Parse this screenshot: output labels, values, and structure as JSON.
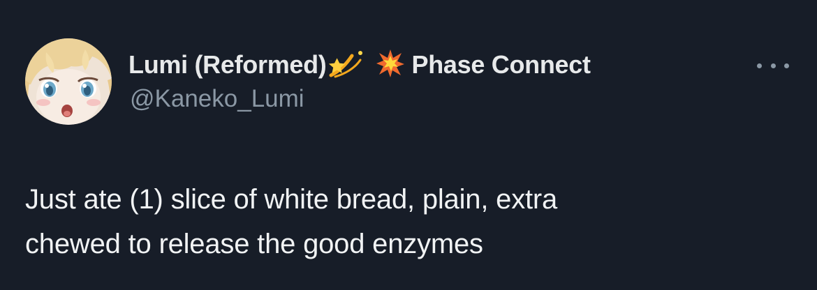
{
  "author": {
    "display_name": "Lumi (Reformed)",
    "handle": "@Kaneko_Lumi",
    "name_emojis": [
      "dizzy-comet-icon",
      "collision-icon"
    ],
    "affiliation": "Phase Connect"
  },
  "tweet": {
    "line1": "Just ate (1) slice of white bread, plain, extra",
    "line2": "chewed to release the good enzymes"
  },
  "menu": {
    "icon": "more-horizontal-icon"
  },
  "colors": {
    "background": "#171d28",
    "text": "#e7e9ea",
    "secondary": "#8b98a5"
  }
}
